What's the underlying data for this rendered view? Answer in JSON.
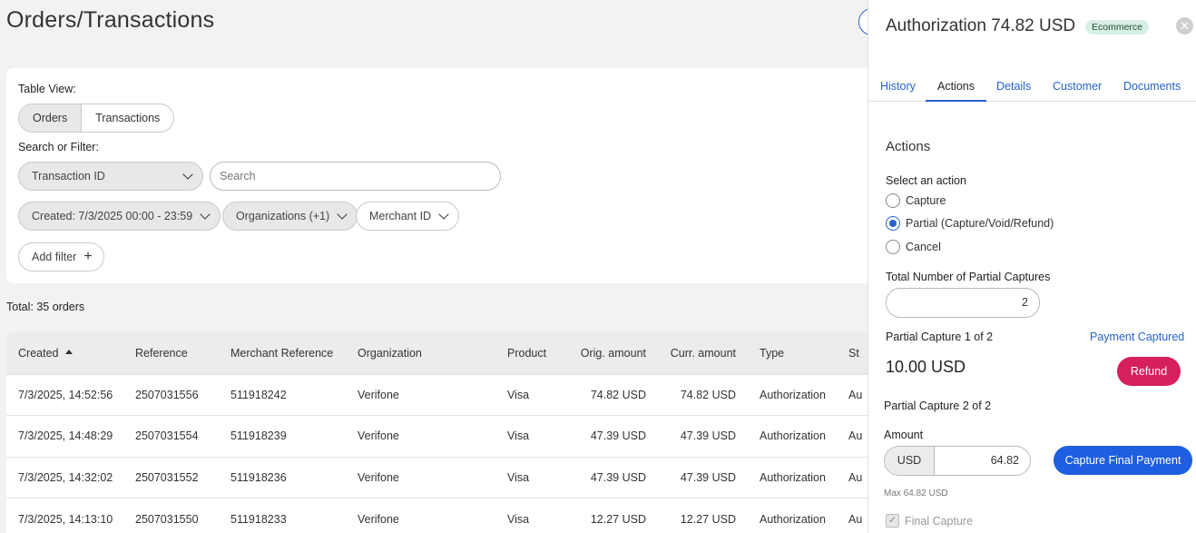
{
  "main": {
    "title": "Orders/Transactions",
    "table_view_label": "Table View:",
    "view_tabs": [
      "Orders",
      "Transactions"
    ],
    "search_filter_label": "Search or Filter:",
    "search_field_select": "Transaction ID",
    "search_placeholder": "Search",
    "filters": {
      "created": "Created: 7/3/2025 00:00 - 23:59",
      "organizations": "Organizations (+1)",
      "merchant_id": "Merchant ID"
    },
    "add_filter": "Add filter",
    "total": "Total: 35 orders"
  },
  "table": {
    "columns": [
      "Created",
      "Reference",
      "Merchant Reference",
      "Organization",
      "Product",
      "Orig. amount",
      "Curr. amount",
      "Type",
      "St"
    ],
    "rows": [
      [
        "7/3/2025, 14:52:56",
        "2507031556",
        "511918242",
        "Verifone",
        "Visa",
        "74.82 USD",
        "74.82 USD",
        "Authorization",
        "Au"
      ],
      [
        "7/3/2025, 14:48:29",
        "2507031554",
        "511918239",
        "Verifone",
        "Visa",
        "47.39 USD",
        "47.39 USD",
        "Authorization",
        "Au"
      ],
      [
        "7/3/2025, 14:32:02",
        "2507031552",
        "511918236",
        "Verifone",
        "Visa",
        "47.39 USD",
        "47.39 USD",
        "Authorization",
        "Au"
      ],
      [
        "7/3/2025, 14:13:10",
        "2507031550",
        "511918233",
        "Verifone",
        "Visa",
        "12.27 USD",
        "12.27 USD",
        "Authorization",
        "Au"
      ]
    ]
  },
  "panel": {
    "title": "Authorization 74.82 USD",
    "badge": "Ecommerce",
    "close_glyph": "✕",
    "tabs": [
      "History",
      "Actions",
      "Details",
      "Customer",
      "Documents"
    ],
    "active_tab": "Actions",
    "section_title": "Actions",
    "select_action_label": "Select an action",
    "actions": [
      "Capture",
      "Partial (Capture/Void/Refund)",
      "Cancel"
    ],
    "selected_action": "Partial (Capture/Void/Refund)",
    "total_partial_label": "Total Number of Partial Captures",
    "total_partial_value": "2",
    "partial1_label": "Partial Capture 1 of 2",
    "partial1_status": "Payment Captured",
    "partial1_amount": "10.00 USD",
    "refund_label": "Refund",
    "partial2_label": "Partial Capture 2 of 2",
    "amount_label": "Amount",
    "currency": "USD",
    "amount_value": "64.82",
    "capture_button": "Capture Final Payment",
    "max_note": "Max 64.82 USD",
    "final_capture_label": "Final Capture",
    "final_capture_glyph": "✓"
  }
}
